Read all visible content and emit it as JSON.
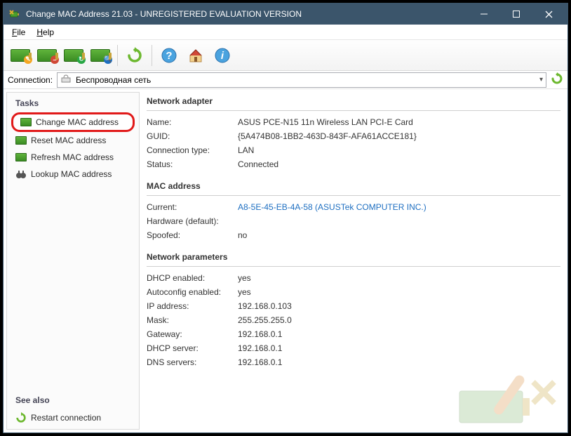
{
  "window": {
    "title": "Change MAC Address 21.03 - UNREGISTERED EVALUATION VERSION"
  },
  "menu": {
    "file": "File",
    "help": "Help"
  },
  "connection": {
    "label": "Connection:",
    "value": "Беспроводная сеть"
  },
  "sidebar": {
    "tasks_head": "Tasks",
    "seealso_head": "See also",
    "items": {
      "change": "Change MAC address",
      "reset": "Reset MAC address",
      "refresh": "Refresh MAC address",
      "lookup": "Lookup MAC address",
      "restart": "Restart connection"
    }
  },
  "sections": {
    "adapter": "Network adapter",
    "mac": "MAC address",
    "params": "Network parameters"
  },
  "adapter": {
    "name_lbl": "Name:",
    "name_val": "ASUS PCE-N15 11n Wireless LAN PCI-E Card",
    "guid_lbl": "GUID:",
    "guid_val": "{5A474B08-1BB2-463D-843F-AFA61ACCE181}",
    "conn_lbl": "Connection type:",
    "conn_val": "LAN",
    "status_lbl": "Status:",
    "status_val": "Connected"
  },
  "mac": {
    "current_lbl": "Current:",
    "current_val": "A8-5E-45-EB-4A-58 (ASUSTek COMPUTER INC.)",
    "hw_lbl": "Hardware (default):",
    "hw_val": "",
    "spoof_lbl": "Spoofed:",
    "spoof_val": "no"
  },
  "params": {
    "dhcp_lbl": "DHCP enabled:",
    "dhcp_val": "yes",
    "auto_lbl": "Autoconfig enabled:",
    "auto_val": "yes",
    "ip_lbl": "IP address:",
    "ip_val": "192.168.0.103",
    "mask_lbl": "Mask:",
    "mask_val": "255.255.255.0",
    "gw_lbl": "Gateway:",
    "gw_val": "192.168.0.1",
    "dhcps_lbl": "DHCP server:",
    "dhcps_val": "192.168.0.1",
    "dns_lbl": "DNS servers:",
    "dns_val": "192.168.0.1"
  }
}
